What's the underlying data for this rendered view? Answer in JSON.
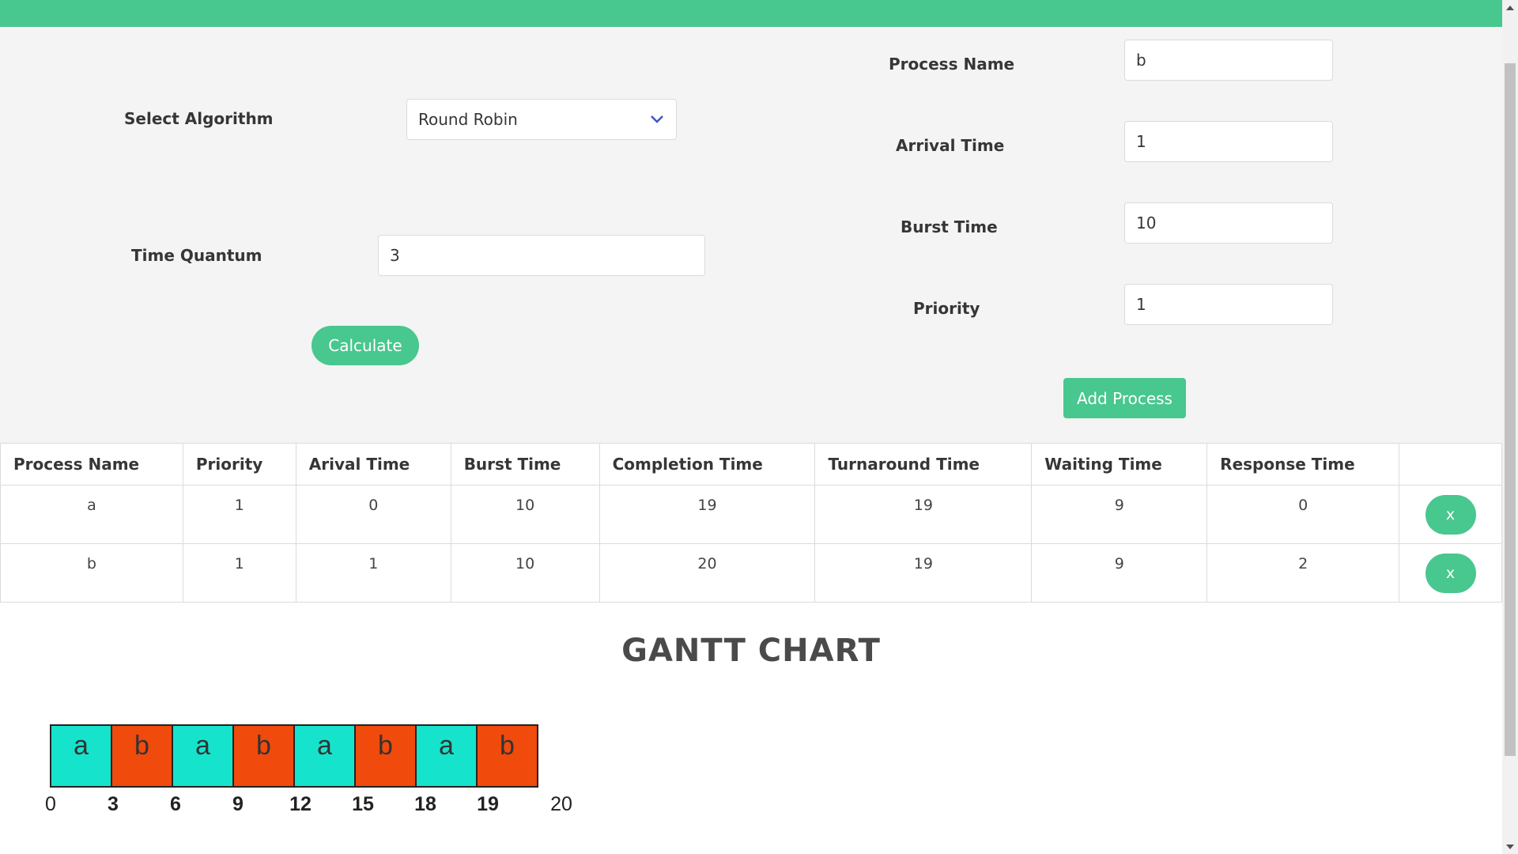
{
  "colors": {
    "accent": "#48c78e",
    "process_a": "#16e3cc",
    "process_b": "#f04a0c"
  },
  "form": {
    "algorithm_label": "Select Algorithm",
    "algorithm_value": "Round Robin",
    "quantum_label": "Time Quantum",
    "quantum_value": "3",
    "calculate_label": "Calculate",
    "process_name_label": "Process Name",
    "process_name_value": "b",
    "arrival_label": "Arrival Time",
    "arrival_value": "1",
    "burst_label": "Burst Time",
    "burst_value": "10",
    "priority_label": "Priority",
    "priority_value": "1",
    "add_label": "Add Process"
  },
  "table": {
    "headers": [
      "Process Name",
      "Priority",
      "Arival Time",
      "Burst Time",
      "Completion Time",
      "Turnaround Time",
      "Waiting Time",
      "Response Time"
    ],
    "rows": [
      {
        "cells": [
          "a",
          "1",
          "0",
          "10",
          "19",
          "19",
          "9",
          "0"
        ],
        "delete_label": "x"
      },
      {
        "cells": [
          "b",
          "1",
          "1",
          "10",
          "20",
          "19",
          "9",
          "2"
        ],
        "delete_label": "x"
      }
    ]
  },
  "gantt": {
    "title": "GANTT CHART",
    "blocks": [
      {
        "label": "a",
        "color": "#16e3cc"
      },
      {
        "label": "b",
        "color": "#f04a0c"
      },
      {
        "label": "a",
        "color": "#16e3cc"
      },
      {
        "label": "b",
        "color": "#f04a0c"
      },
      {
        "label": "a",
        "color": "#16e3cc"
      },
      {
        "label": "b",
        "color": "#f04a0c"
      },
      {
        "label": "a",
        "color": "#16e3cc"
      },
      {
        "label": "b",
        "color": "#f04a0c"
      }
    ],
    "ticks": [
      "0",
      "3",
      "6",
      "9",
      "12",
      "15",
      "18",
      "19",
      "20"
    ]
  }
}
